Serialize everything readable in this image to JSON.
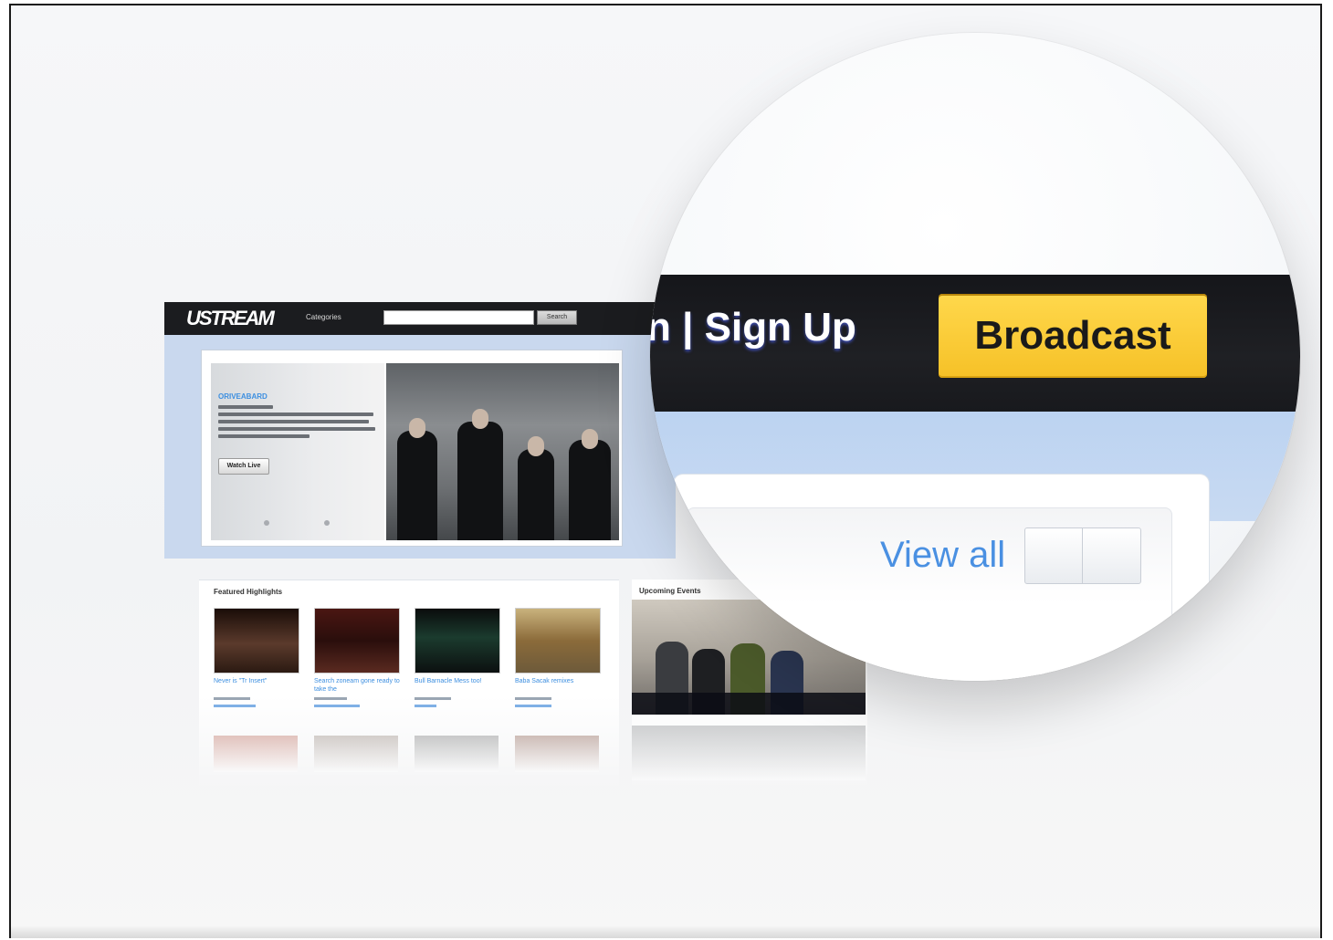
{
  "mini_site": {
    "logo": "USTREAM",
    "nav_categories": "Categories",
    "search_button": "Search",
    "hero": {
      "title": "ORIVEABARD",
      "watch_label": "Watch Live"
    },
    "featured_label": "Featured Highlights",
    "events_label": "Upcoming Events",
    "thumbnails": [
      {
        "title": "Never is \"Tr Insert\""
      },
      {
        "title": "Search zoneam gone ready to take the"
      },
      {
        "title": "Bull Barnacle Mess too!"
      },
      {
        "title": "Baba Sacak remixes"
      }
    ]
  },
  "magnifier": {
    "auth_text": "n | Sign Up",
    "broadcast_label": "Broadcast",
    "view_all_label": "View all"
  },
  "colors": {
    "accent_yellow": "#f6c127",
    "link_blue": "#4a90e2",
    "header_dark": "#1b1c1f",
    "band_blue": "#c9d8ee"
  }
}
